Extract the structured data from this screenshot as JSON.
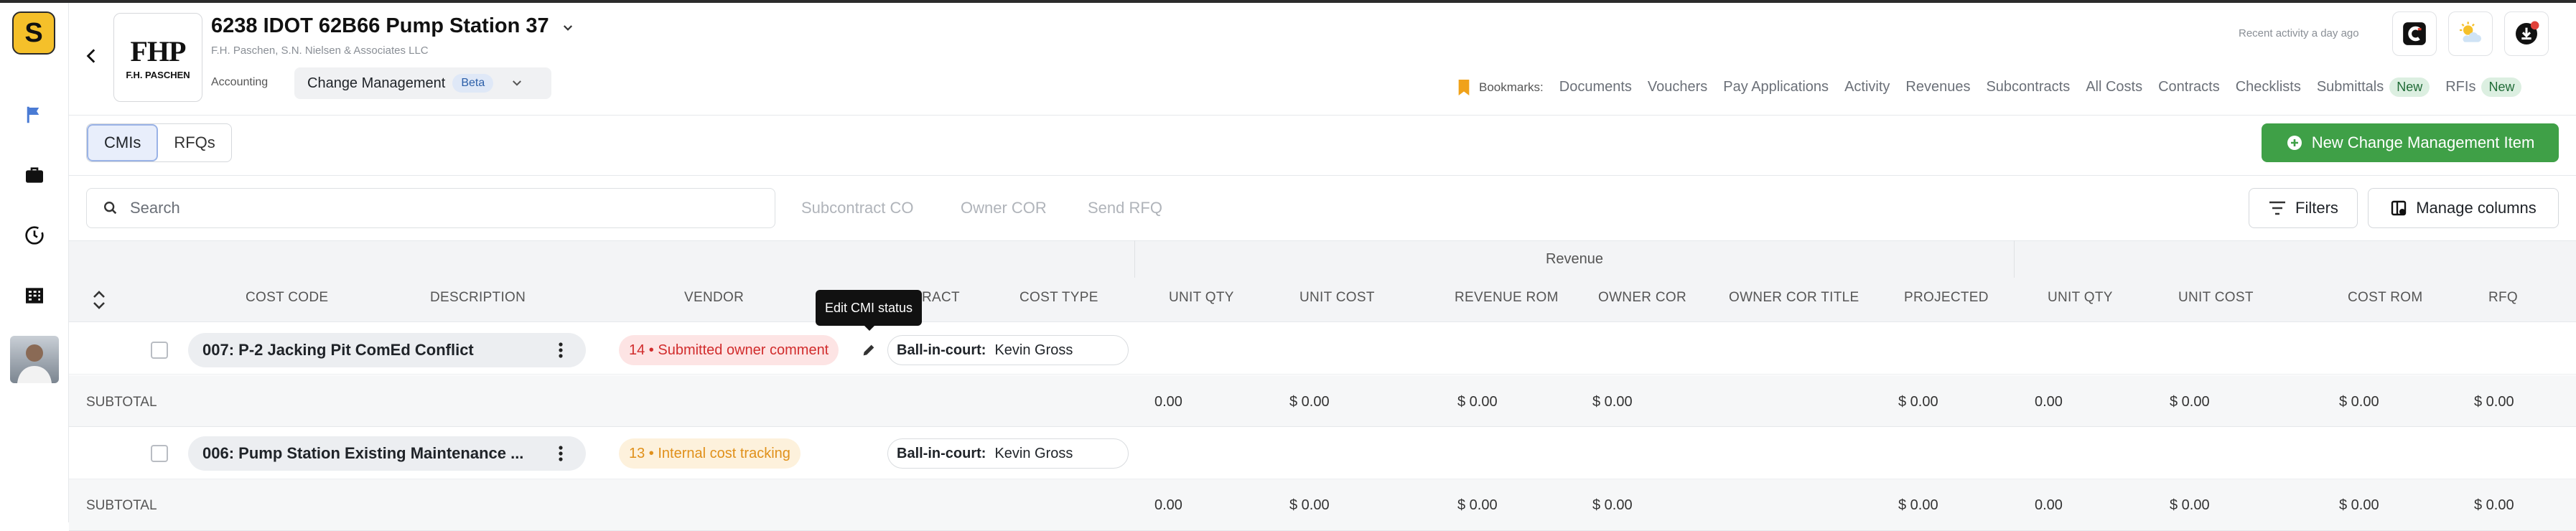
{
  "app": {
    "logo_letter": "S"
  },
  "project": {
    "title": "6238 IDOT 62B66 Pump Station 37",
    "company": "F.H. Paschen, S.N. Nielsen & Associates LLC",
    "logo_text_large": "FHP",
    "logo_text_small": "F.H. PASCHEN"
  },
  "nav": {
    "accounting": "Accounting",
    "module": "Change Management",
    "module_badge": "Beta"
  },
  "header": {
    "recent_activity": "Recent activity a day ago"
  },
  "bookmarks": {
    "label": "Bookmarks:",
    "items": [
      {
        "label": "Documents"
      },
      {
        "label": "Vouchers"
      },
      {
        "label": "Pay Applications"
      },
      {
        "label": "Activity"
      },
      {
        "label": "Revenues"
      },
      {
        "label": "Subcontracts"
      },
      {
        "label": "All Costs"
      },
      {
        "label": "Contracts"
      },
      {
        "label": "Checklists"
      },
      {
        "label": "Submittals",
        "badge": "New"
      },
      {
        "label": "RFIs",
        "badge": "New"
      }
    ]
  },
  "tabs": {
    "cmis": "CMIs",
    "rfqs": "RFQs"
  },
  "actions": {
    "new_cmi": "New Change Management Item",
    "filters": "Filters",
    "manage_columns": "Manage columns"
  },
  "toolbar": {
    "search_placeholder": "Search",
    "subcontract_co": "Subcontract CO",
    "owner_cor": "Owner COR",
    "send_rfq": "Send RFQ"
  },
  "table": {
    "group_revenue": "Revenue",
    "columns": {
      "cost_code": "COST CODE",
      "description": "DESCRIPTION",
      "vendor": "VENDOR",
      "contract": "RACT",
      "cost_type": "COST TYPE",
      "unit_qty": "UNIT QTY",
      "unit_cost": "UNIT COST",
      "revenue_rom": "REVENUE ROM",
      "owner_cor": "OWNER COR",
      "owner_cor_title": "OWNER COR TITLE",
      "projected": "PROJECTED",
      "unit_qty_2": "UNIT QTY",
      "unit_cost_2": "UNIT COST",
      "cost_rom": "COST ROM",
      "rfq": "RFQ"
    },
    "tooltip": "Edit CMI status",
    "rows": [
      {
        "title": "007: P-2 Jacking Pit ComEd Conflict",
        "status": "14 • Submitted owner comment",
        "bic_label": "Ball-in-court:",
        "bic_value": "Kevin Gross",
        "subtotal_label": "SUBTOTAL",
        "subtotal": [
          "0.00",
          "$ 0.00",
          "$ 0.00",
          "$ 0.00",
          "$ 0.00",
          "0.00",
          "$ 0.00",
          "$ 0.00",
          "$ 0.00"
        ]
      },
      {
        "title": "006: Pump Station Existing Maintenance ...",
        "status": "13 • Internal cost tracking",
        "bic_label": "Ball-in-court:",
        "bic_value": "Kevin Gross",
        "subtotal_label": "SUBTOTAL",
        "subtotal": [
          "0.00",
          "$ 0.00",
          "$ 0.00",
          "$ 0.00",
          "$ 0.00",
          "0.00",
          "$ 0.00",
          "$ 0.00",
          "$ 0.00"
        ]
      }
    ]
  },
  "colors": {
    "accent_green": "#3fa047",
    "status_red": "#d12c2c",
    "status_orange": "#e0901a",
    "beta_blue": "#2c5fa8"
  }
}
